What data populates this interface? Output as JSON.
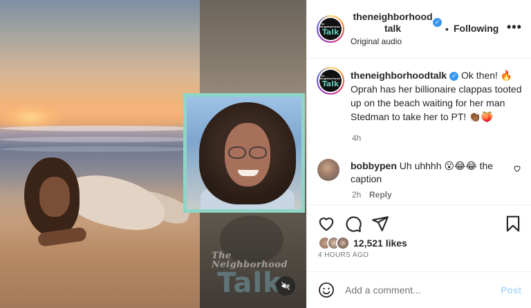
{
  "post": {
    "username": "theneighborhoodtalk",
    "username_wrapped": "theneighborhood talk",
    "verified": true,
    "dot": "•",
    "follow_state": "Following",
    "more_label": "•••",
    "audio": "Original audio",
    "logo_top": "The Neighborhood",
    "logo_talk": "Talk"
  },
  "media": {
    "watermark_small": "The Neighborhood",
    "watermark_big": "Talk",
    "mute_icon": "speaker-muted-icon",
    "inset_border_color": "#8fd6c8"
  },
  "caption": {
    "username": "theneighborhoodtalk",
    "text": " Ok then! 🔥 Oprah has her billionaire clappas tooted up on the beach waiting for her man Stedman to take her to PT! 👏🏾🍑",
    "time": "4h"
  },
  "comment": {
    "username": "bobbypen",
    "text": " Uh uhhhh 😮😂😂 the caption",
    "time": "2h",
    "reply_label": "Reply"
  },
  "actions": {
    "like_icon": "heart-icon",
    "comment_icon": "comment-icon",
    "share_icon": "send-icon",
    "save_icon": "bookmark-icon",
    "likes": "12,521 likes",
    "date": "4 HOURS AGO"
  },
  "add_comment": {
    "placeholder": "Add a comment...",
    "post_label": "Post"
  },
  "colors": {
    "verified": "#3897f0",
    "post_disabled": "#b3dbff",
    "secondary_text": "#737373"
  }
}
